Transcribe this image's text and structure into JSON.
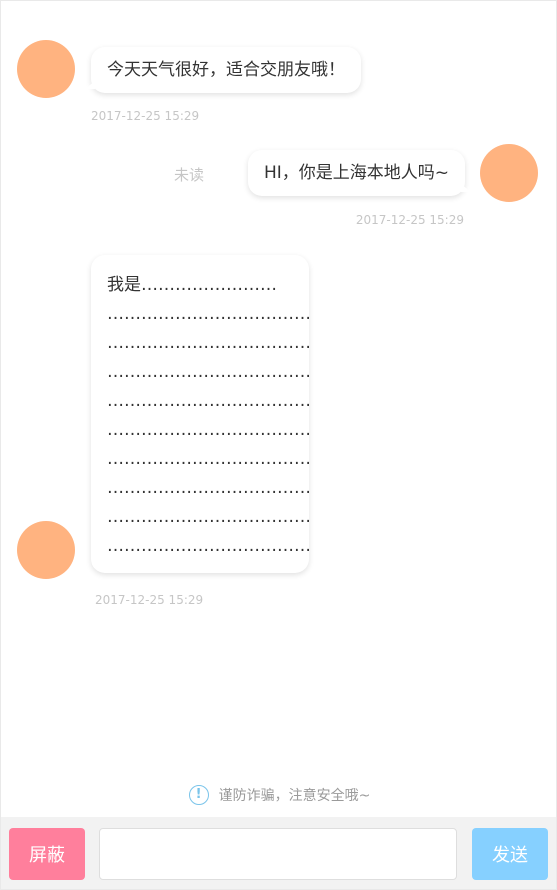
{
  "messages": [
    {
      "side": "left",
      "text": "今天天气很好，适合交朋友哦！",
      "time": "2017-12-25 15:29"
    },
    {
      "side": "right",
      "text": "HI，你是上海本地人吗~",
      "status": "未读",
      "time": "2017-12-25 15:29"
    },
    {
      "side": "left",
      "text": "我是……………………\n………………………………\n………………………………\n………………………………\n………………………………\n………………………………\n………………………………\n………………………………\n………………………………\n………………………………",
      "time": "2017-12-25 15:29"
    }
  ],
  "notice": {
    "icon": "info-icon",
    "text": "谨防诈骗，注意安全哦~"
  },
  "bottom_bar": {
    "block_label": "屏蔽",
    "send_label": "发送",
    "input_value": "",
    "input_placeholder": ""
  },
  "colors": {
    "avatar": "#ffb380",
    "block_button": "#ff7f9c",
    "send_button": "#86d0ff",
    "timestamp": "#c6c6c6",
    "info_icon": "#7ac4ea"
  }
}
